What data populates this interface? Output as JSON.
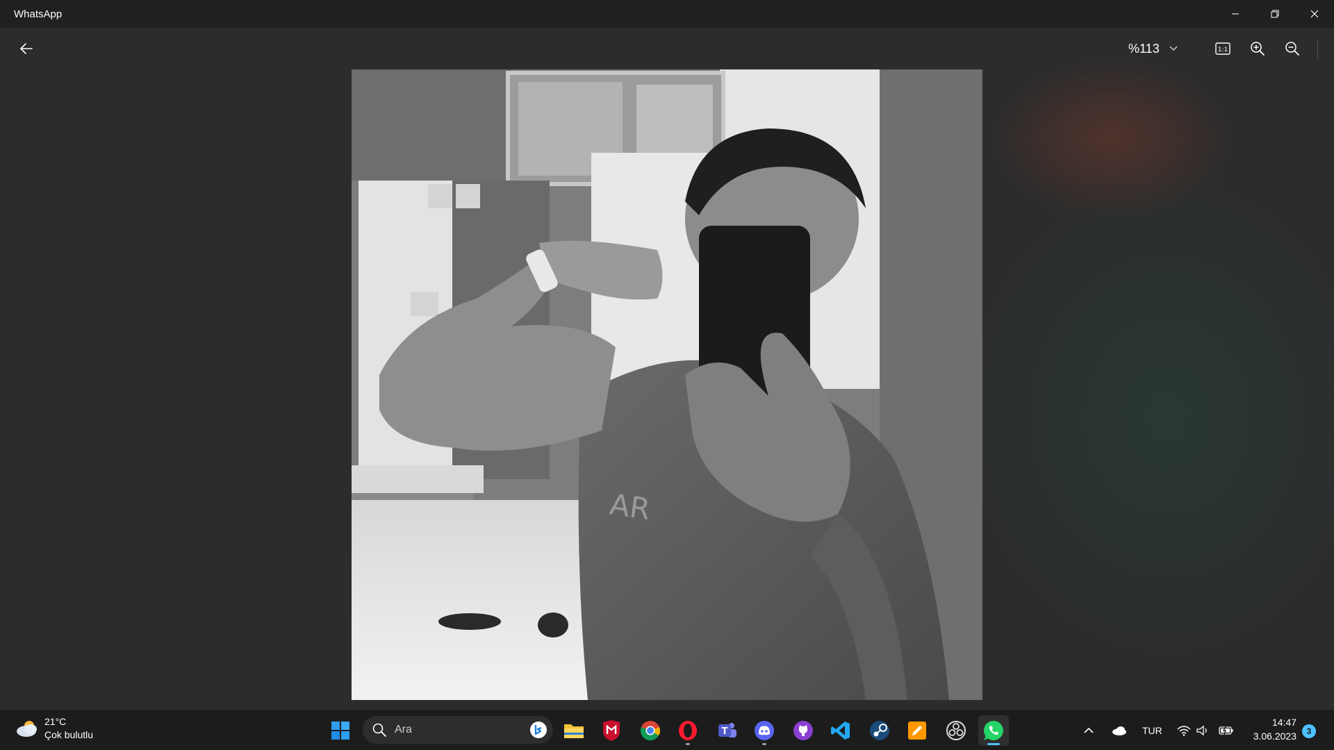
{
  "window": {
    "title": "WhatsApp",
    "controls": [
      "minimize",
      "restore",
      "close"
    ]
  },
  "viewer": {
    "zoom_value": "%113",
    "toolbar_icons": [
      "back-arrow-icon",
      "chevron-down-icon",
      "actual-size-icon",
      "zoom-in-icon",
      "zoom-out-icon"
    ]
  },
  "taskbar": {
    "weather": {
      "temperature": "21°C",
      "condition": "Çok bulutlu"
    },
    "search_placeholder": "Ara",
    "apps": [
      "windows-start",
      "file-explorer",
      "mcafee",
      "chrome",
      "opera",
      "teams",
      "discord",
      "github-desktop",
      "vscode",
      "steam",
      "sublime-text",
      "obs-studio",
      "whatsapp"
    ],
    "tray": {
      "language": "TUR"
    },
    "clock": {
      "time": "14:47",
      "date": "3.06.2023"
    },
    "notification_count": "3"
  },
  "colors": {
    "accent": "#4cc2ff",
    "titlebar": "#202020",
    "taskbar": "#1c1c1c",
    "background": "#2b2c2c"
  }
}
